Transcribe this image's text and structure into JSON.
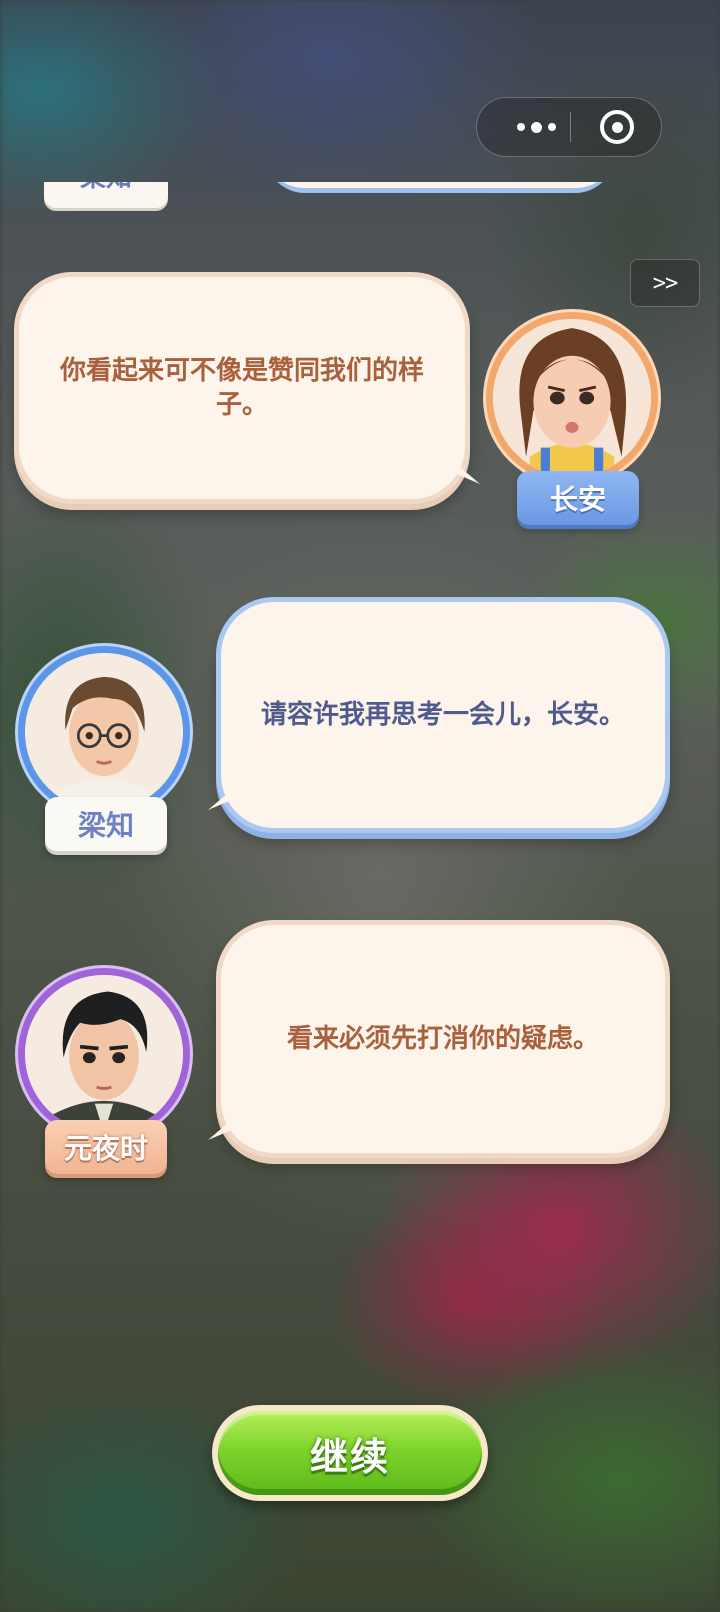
{
  "controls": {
    "skip_label": ">>",
    "continue_label": "继续"
  },
  "previous": {
    "speaker": "梁知"
  },
  "dialogue": [
    {
      "speaker": "长安",
      "text": "你看起来可不像是赞同我们的样子。",
      "side": "right",
      "style": "peach"
    },
    {
      "speaker": "梁知",
      "text": "请容许我再思考一会儿，长安。",
      "side": "left",
      "style": "blue"
    },
    {
      "speaker": "元夜时",
      "text": "看来必须先打消你的疑虑。",
      "side": "left",
      "style": "peach"
    }
  ],
  "colors": {
    "changan_ring": "#f2a76c",
    "liangzhi_ring": "#5c96e8",
    "yuanyeshi_ring": "#a064d8",
    "continue_green": "#7ed42c"
  },
  "icons": {
    "capsule_more": "more-dots-icon",
    "capsule_close": "target-close-icon"
  }
}
